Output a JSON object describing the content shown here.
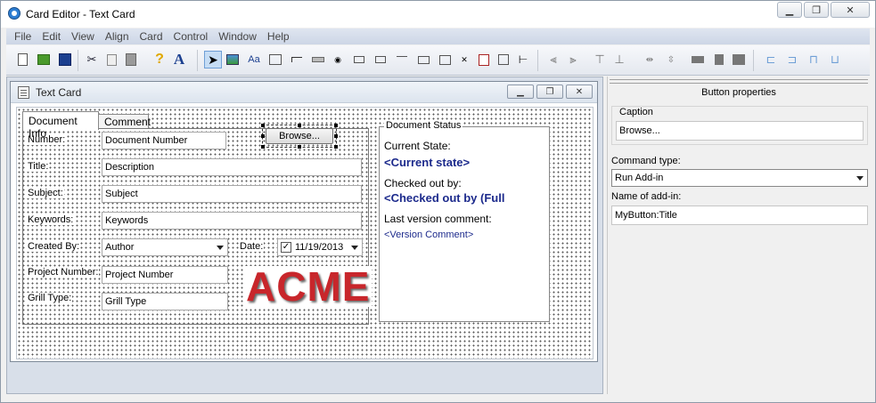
{
  "window": {
    "title": "Card Editor - Text Card"
  },
  "menu": [
    "File",
    "Edit",
    "View",
    "Align",
    "Card",
    "Control",
    "Window",
    "Help"
  ],
  "child": {
    "title": "Text Card"
  },
  "tabs": [
    "Document Info",
    "Comment"
  ],
  "form": {
    "number_label": "Number:",
    "number_value": "Document Number",
    "browse_label": "Browse...",
    "title_label": "Title:",
    "title_value": "Description",
    "subject_label": "Subject:",
    "subject_value": "Subject",
    "keywords_label": "Keywords:",
    "keywords_value": "Keywords",
    "created_label": "Created By:",
    "created_value": "Author",
    "date_label": "Date:",
    "date_value": "11/19/2013",
    "date_check": "✓",
    "project_label": "Project Number:",
    "project_value": "Project Number",
    "grill_label": "Grill Type:",
    "grill_value": "Grill Type",
    "logo_text": "ACME"
  },
  "status": {
    "group_title": "Document Status",
    "current_state_label": "Current State:",
    "current_state_value": "<Current state>",
    "checked_out_label": "Checked out by:",
    "checked_out_value": "<Checked out by (Full",
    "last_comment_label": "Last version comment:",
    "last_comment_value": "<Version Comment>"
  },
  "properties": {
    "title": "Button properties",
    "caption_label": "Caption",
    "caption_value": "Browse...",
    "command_type_label": "Command type:",
    "command_type_value": "Run Add-in",
    "addin_label": "Name of add-in:",
    "addin_value": "MyButton:Title"
  },
  "colors": {
    "accent": "#1c2a8c",
    "logo": "#c8262b"
  }
}
